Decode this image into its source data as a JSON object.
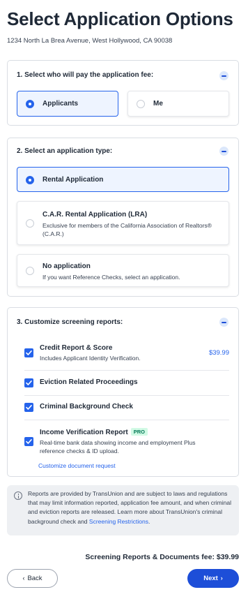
{
  "header": {
    "title": "Select Application Options",
    "address": "1234 North La Brea Avenue, West Hollywood, CA 90038"
  },
  "payer_section": {
    "title": "1. Select who will pay the application fee:",
    "options": [
      {
        "label": "Applicants",
        "selected": true
      },
      {
        "label": "Me",
        "selected": false
      }
    ]
  },
  "type_section": {
    "title": "2. Select an application type:",
    "options": [
      {
        "label": "Rental Application",
        "description": "",
        "selected": true
      },
      {
        "label": "C.A.R. Rental Application (LRA)",
        "description": "Exclusive for members of the California Association of Realtors® (C.A.R.)",
        "selected": false
      },
      {
        "label": "No application",
        "description": "If you want Reference Checks, select an application.",
        "selected": false
      }
    ]
  },
  "reports_section": {
    "title": "3. Customize screening reports:",
    "reports": [
      {
        "label": "Credit Report & Score",
        "description": "Includes Applicant Identity Verification.",
        "price": "$39.99",
        "checked": true
      },
      {
        "label": "Eviction Related Proceedings",
        "checked": true
      },
      {
        "label": "Criminal Background Check",
        "checked": true
      },
      {
        "label": "Income Verification Report",
        "badge": "PRO",
        "description": "Real-time bank data showing income and employment Plus reference checks & ID upload.",
        "checked": true
      }
    ],
    "customize_link": "Customize document request"
  },
  "disclaimer": {
    "text": "Reports are provided by TransUnion and are subject to laws and regulations that may limit information reported, application fee amount, and when criminal and eviction reports are released. Learn more about TransUnion's criminal background check and ",
    "link": "Screening Restrictions",
    "end": "."
  },
  "footer": {
    "fee_text": "Screening Reports & Documents fee: $39.99",
    "back_label": "Back",
    "next_label": "Next"
  },
  "colors": {
    "accent": "#2563eb",
    "next_button": "#1d4ed8",
    "selected_bg": "#eef4ff",
    "pro_badge_bg": "#d1fae5",
    "pro_badge_text": "#047857"
  },
  "icons": [
    "collapse-minus-icon",
    "radio-icon",
    "checkbox-check-icon",
    "info-icon",
    "chevron-left-icon",
    "chevron-right-icon"
  ]
}
